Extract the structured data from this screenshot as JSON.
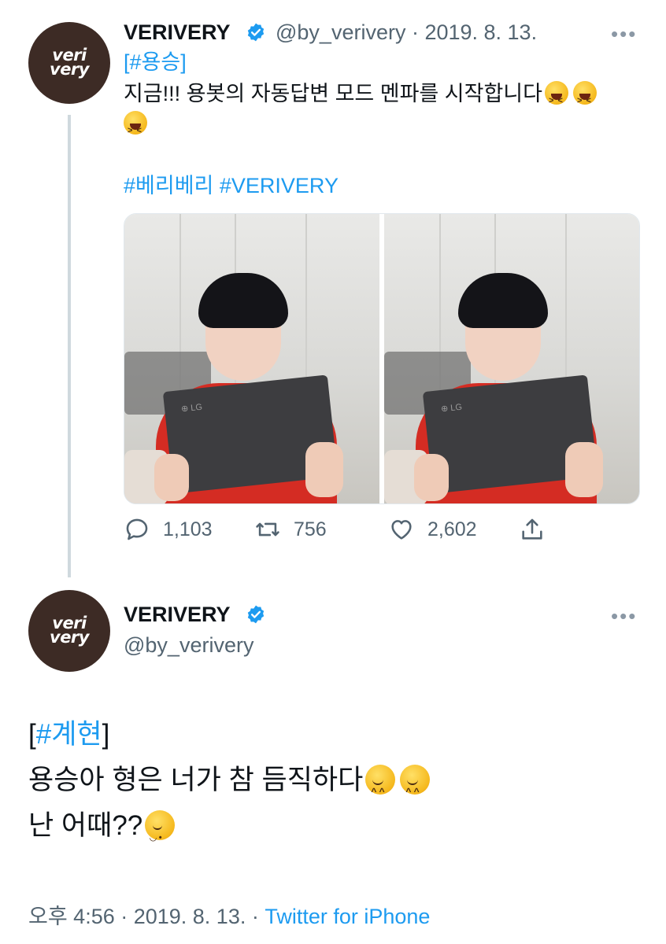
{
  "tweet1": {
    "avatar_line1": "veri",
    "avatar_line2": "very",
    "name": "VERIVERY",
    "handle_date": "@by_verivery · 2019. 8. 13.",
    "more": "•••",
    "hashtag_tag": "[#용승]",
    "body": "지금!!! 용봇의 자동답변 모드 멘파를 시작합니다",
    "hashtags": "#베리베리 #VERIVERY",
    "replies": "1,103",
    "retweets": "756",
    "likes": "2,602"
  },
  "tweet2": {
    "avatar_line1": "veri",
    "avatar_line2": "very",
    "name": "VERIVERY",
    "handle": "@by_verivery",
    "more": "•••",
    "bracket_open": "[",
    "hashtag": "#계현",
    "bracket_close": "]",
    "line1": "용승아 형은 너가 참 듬직하다",
    "line2": "난 어때??",
    "time": "오후 4:56 · 2019. 8. 13. · ",
    "source": "Twitter for iPhone"
  },
  "icons": {
    "verified": "verified-badge-icon",
    "reply": "reply-icon",
    "retweet": "retweet-icon",
    "like": "heart-icon",
    "share": "share-icon"
  },
  "colors": {
    "link": "#1d9bf0",
    "muted": "#536471",
    "verified": "#1d9bf0",
    "avatar_bg": "#3d2b25"
  }
}
